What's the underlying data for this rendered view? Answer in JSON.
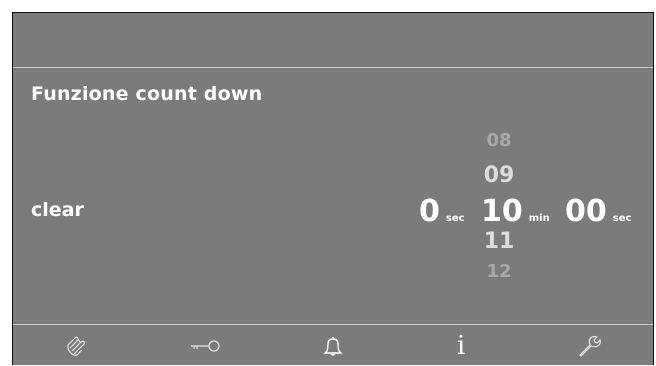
{
  "screen": {
    "title": "Funzione count down",
    "left_label": "clear"
  },
  "countdown": {
    "seconds_left": "0",
    "seconds_left_unit": "sec",
    "minutes": {
      "prev2": "08",
      "prev1": "09",
      "selected": "10",
      "next1": "11",
      "next2": "12",
      "unit": "min"
    },
    "seconds_right": "00",
    "seconds_right_unit": "sec"
  },
  "bottom_nav": {
    "items": [
      {
        "icon": "hand-icon"
      },
      {
        "icon": "key-icon"
      },
      {
        "icon": "bell-icon"
      },
      {
        "icon": "info-icon",
        "glyph": "i"
      },
      {
        "icon": "wrench-icon"
      }
    ]
  },
  "colors": {
    "panel": "#7b7b7b",
    "divider": "#c8c8c8",
    "text": "#ffffff",
    "faded_text": "#a9a9a9"
  }
}
